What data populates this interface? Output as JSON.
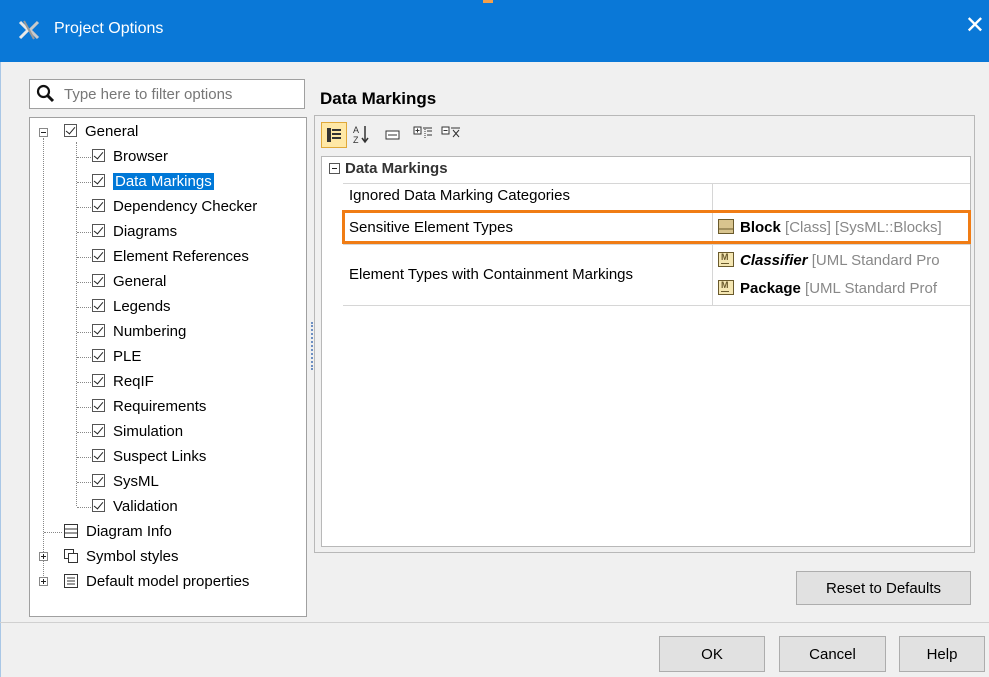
{
  "window": {
    "title": "Project Options",
    "close_glyph": "✕"
  },
  "search": {
    "placeholder": "Type here to filter options"
  },
  "tree": {
    "root": "General",
    "children": [
      "Browser",
      "Data Markings",
      "Dependency Checker",
      "Diagrams",
      "Element References",
      "General",
      "Legends",
      "Numbering",
      "PLE",
      "ReqIF",
      "Requirements",
      "Simulation",
      "Suspect Links",
      "SysML",
      "Validation"
    ],
    "others": [
      "Diagram Info",
      "Symbol styles",
      "Default model properties"
    ],
    "selected": "Data Markings"
  },
  "panel": {
    "title": "Data Markings",
    "toolbar": [
      "categorized-view-icon",
      "sort-alphabetically-icon",
      "description-icon",
      "expand-all-icon",
      "collapse-all-icon"
    ],
    "category": "Data Markings",
    "properties": [
      {
        "name": "Ignored Data Marking Categories",
        "values": []
      },
      {
        "name": "Sensitive Element Types",
        "values": [
          {
            "icon": "block-icon",
            "main": "Block",
            "italic": false,
            "meta": " [Class] [SysML::Blocks]"
          }
        ]
      },
      {
        "name": "Element Types with Containment Markings",
        "values": [
          {
            "icon": "metaclass-icon",
            "main": "Classifier",
            "italic": true,
            "meta": " [UML Standard Pro"
          },
          {
            "icon": "metaclass-icon",
            "main": "Package",
            "italic": false,
            "meta": " [UML Standard Prof"
          }
        ]
      }
    ],
    "highlight_color": "#f07c14"
  },
  "buttons": {
    "reset": "Reset to Defaults",
    "ok": "OK",
    "cancel": "Cancel",
    "help": "Help"
  },
  "colors": {
    "titlebar": "#0a78d7",
    "selection": "#0078d7",
    "toolbar_active": "#ffe8a6"
  }
}
